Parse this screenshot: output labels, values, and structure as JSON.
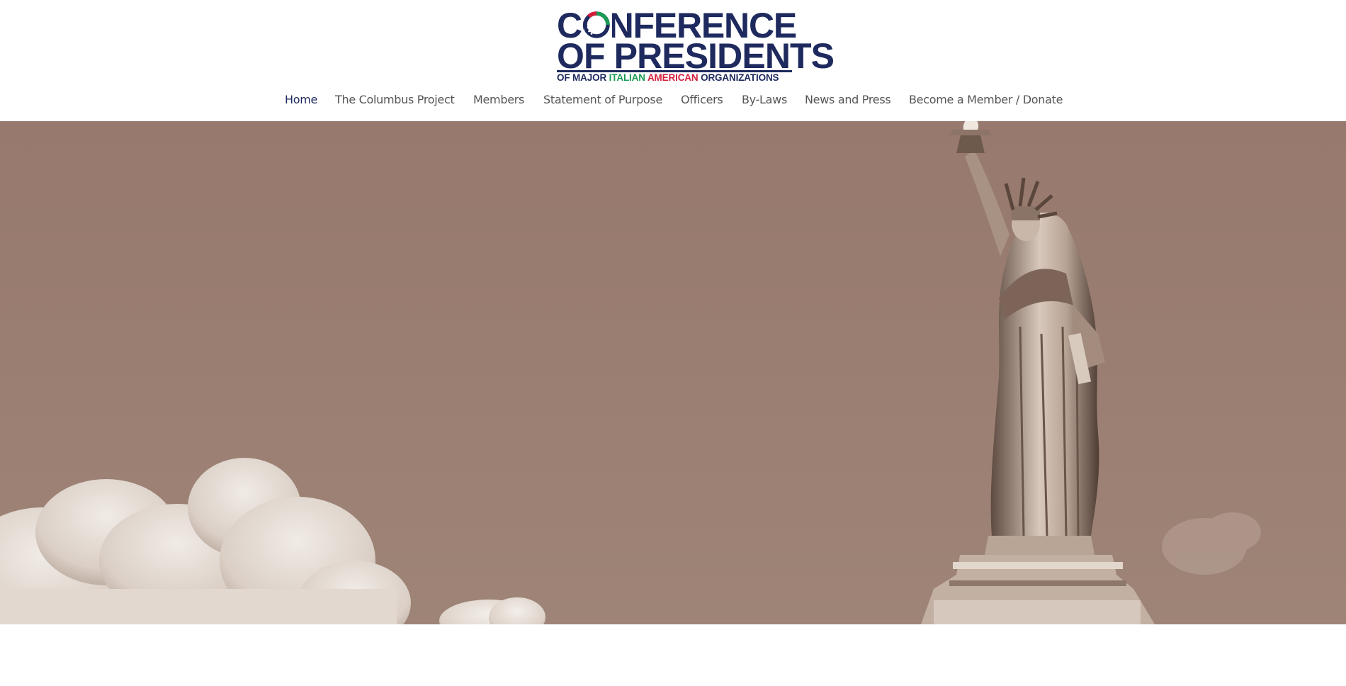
{
  "logo": {
    "line1": "CONFERENCE",
    "line2": "OF PRESIDENTS",
    "line3_part1": "OF MAJOR ",
    "line3_part2": "ITALIAN ",
    "line3_part3": "AMERICAN ",
    "line3_part4": "ORGANIZATIONS",
    "colors": {
      "navy": "#1e2a5e",
      "green": "#1b9a55",
      "red": "#d31f3b"
    }
  },
  "nav": {
    "items": [
      {
        "label": "Home",
        "active": true
      },
      {
        "label": "The Columbus Project",
        "active": false
      },
      {
        "label": "Members",
        "active": false
      },
      {
        "label": "Statement of Purpose",
        "active": false
      },
      {
        "label": "Officers",
        "active": false
      },
      {
        "label": "By-Laws",
        "active": false
      },
      {
        "label": "News and Press",
        "active": false
      },
      {
        "label": "Become a Member / Donate",
        "active": false
      }
    ],
    "active_color": "#1e2a5e",
    "text_color": "#555555"
  },
  "hero": {
    "background_color": "#997e72",
    "image_subject": "statue-of-liberty-with-clouds"
  }
}
